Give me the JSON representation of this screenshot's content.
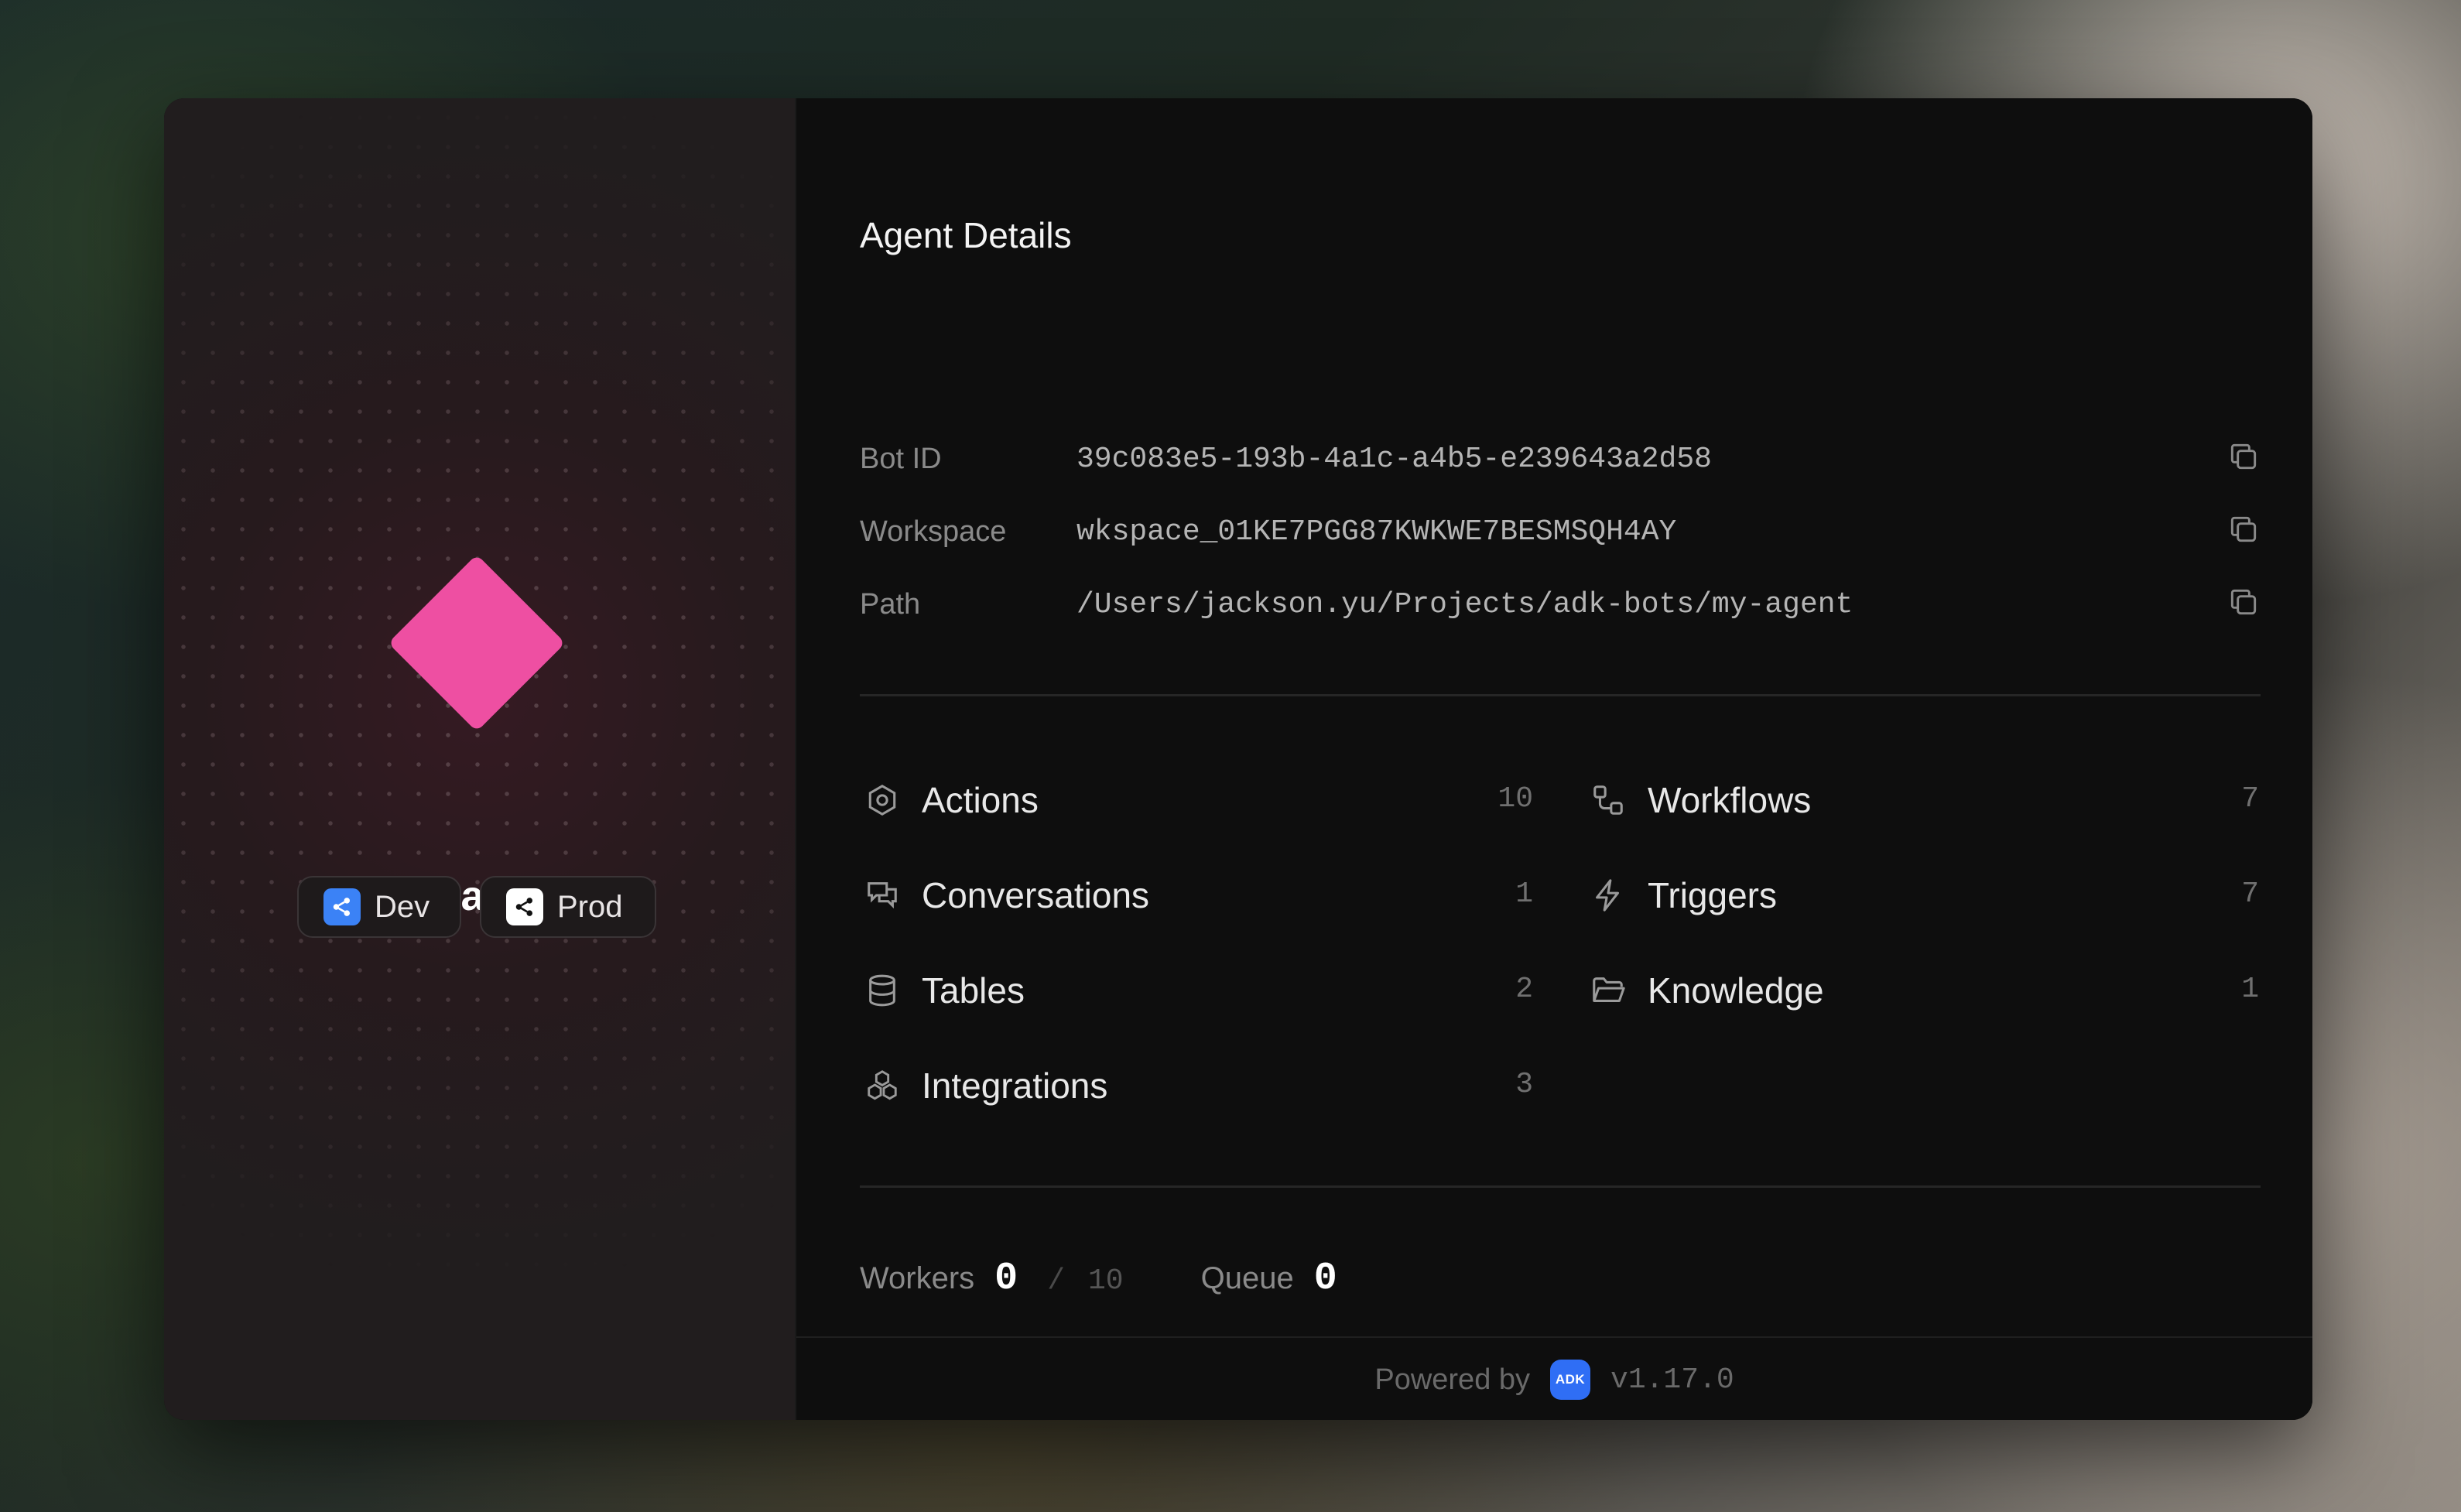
{
  "agent": {
    "name": "my-agent",
    "accent_color": "#ee4fa2"
  },
  "environments": [
    {
      "label": "Dev",
      "icon": "share-icon",
      "color": "#3b82f6"
    },
    {
      "label": "Prod",
      "icon": "share-icon",
      "color": "#ffffff"
    }
  ],
  "details": {
    "title": "Agent Details",
    "rows": [
      {
        "label": "Bot ID",
        "value": "39c083e5-193b-4a1c-a4b5-e239643a2d58"
      },
      {
        "label": "Workspace",
        "value": "wkspace_01KE7PGG87KWKWE7BESMSQH4AY"
      },
      {
        "label": "Path",
        "value": "/Users/jackson.yu/Projects/adk-bots/my-agent"
      }
    ]
  },
  "stats": [
    {
      "label": "Actions",
      "count": "10",
      "icon": "hexagon-icon"
    },
    {
      "label": "Workflows",
      "count": "7",
      "icon": "workflow-icon"
    },
    {
      "label": "Conversations",
      "count": "1",
      "icon": "chat-icon"
    },
    {
      "label": "Triggers",
      "count": "7",
      "icon": "lightning-icon"
    },
    {
      "label": "Tables",
      "count": "2",
      "icon": "database-icon"
    },
    {
      "label": "Knowledge",
      "count": "1",
      "icon": "folder-icon"
    },
    {
      "label": "Integrations",
      "count": "3",
      "icon": "boxes-icon"
    }
  ],
  "metrics": {
    "workers_label": "Workers",
    "workers_value": "0",
    "workers_separator": "/",
    "workers_max": "10",
    "queue_label": "Queue",
    "queue_value": "0"
  },
  "footer": {
    "powered_by": "Powered by",
    "logo_text": "ADK",
    "version": "v1.17.0"
  }
}
